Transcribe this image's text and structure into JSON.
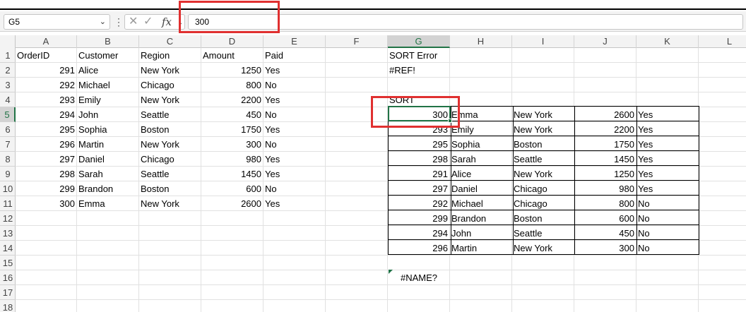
{
  "namebox": {
    "value": "G5"
  },
  "formula_bar": {
    "value": "300",
    "fx_label": "fx"
  },
  "columns": [
    "A",
    "B",
    "C",
    "D",
    "E",
    "F",
    "G",
    "H",
    "I",
    "J",
    "K",
    "L"
  ],
  "selected_column": "G",
  "rows": [
    "1",
    "2",
    "3",
    "4",
    "5",
    "6",
    "7",
    "8",
    "9",
    "10",
    "11",
    "12",
    "13",
    "14",
    "15",
    "16",
    "17",
    "18"
  ],
  "selected_row": "5",
  "source_table": {
    "headers": [
      "OrderID",
      "Customer",
      "Region",
      "Amount",
      "Paid"
    ],
    "rows": [
      [
        "291",
        "Alice",
        "New York",
        "1250",
        "Yes"
      ],
      [
        "292",
        "Michael",
        "Chicago",
        "800",
        "No"
      ],
      [
        "293",
        "Emily",
        "New York",
        "2200",
        "Yes"
      ],
      [
        "294",
        "John",
        "Seattle",
        "450",
        "No"
      ],
      [
        "295",
        "Sophia",
        "Boston",
        "1750",
        "Yes"
      ],
      [
        "296",
        "Martin",
        "New York",
        "300",
        "No"
      ],
      [
        "297",
        "Daniel",
        "Chicago",
        "980",
        "Yes"
      ],
      [
        "298",
        "Sarah",
        "Seattle",
        "1450",
        "Yes"
      ],
      [
        "299",
        "Brandon",
        "Boston",
        "600",
        "No"
      ],
      [
        "300",
        "Emma",
        "New York",
        "2600",
        "Yes"
      ]
    ]
  },
  "sort_error_label": "SORT Error",
  "sort_error_value": "#REF!",
  "sort_label": "SORT",
  "sorted_table": {
    "rows": [
      [
        "300",
        "Emma",
        "New York",
        "2600",
        "Yes"
      ],
      [
        "293",
        "Emily",
        "New York",
        "2200",
        "Yes"
      ],
      [
        "295",
        "Sophia",
        "Boston",
        "1750",
        "Yes"
      ],
      [
        "298",
        "Sarah",
        "Seattle",
        "1450",
        "Yes"
      ],
      [
        "291",
        "Alice",
        "New York",
        "1250",
        "Yes"
      ],
      [
        "297",
        "Daniel",
        "Chicago",
        "980",
        "Yes"
      ],
      [
        "292",
        "Michael",
        "Chicago",
        "800",
        "No"
      ],
      [
        "299",
        "Brandon",
        "Boston",
        "600",
        "No"
      ],
      [
        "294",
        "John",
        "Seattle",
        "450",
        "No"
      ],
      [
        "296",
        "Martin",
        "New York",
        "300",
        "No"
      ]
    ]
  },
  "name_error_value": "#NAME?",
  "colors": {
    "accent": "#217346",
    "highlight": "#e03030"
  }
}
